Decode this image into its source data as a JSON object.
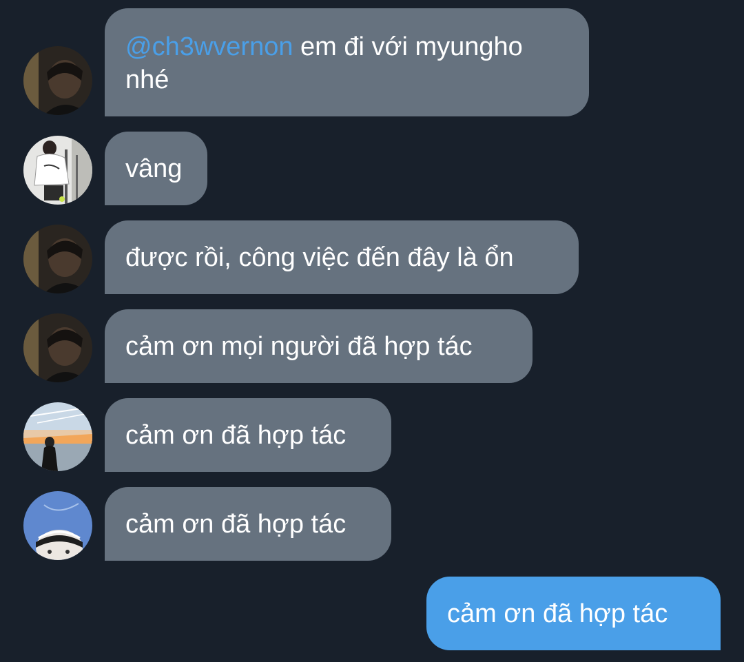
{
  "chat": {
    "background_color": "#18202b",
    "incoming_bubble_color": "#66727f",
    "outgoing_bubble_color": "#4a9fe8",
    "mention_color": "#4a9fe8",
    "messages": [
      {
        "sender": "incoming",
        "avatar": "avatar-dark-portrait",
        "mention": "@ch3wvernon",
        "text": " em đi với myungho nhé"
      },
      {
        "sender": "incoming",
        "avatar": "avatar-white-shirt",
        "text": "vâng"
      },
      {
        "sender": "incoming",
        "avatar": "avatar-dark-portrait",
        "text": "được rồi, công việc đến đây là ổn"
      },
      {
        "sender": "incoming",
        "avatar": "avatar-dark-portrait",
        "text": "cảm ơn mọi người đã hợp tác"
      },
      {
        "sender": "incoming",
        "avatar": "avatar-sunset-beach",
        "text": "cảm ơn đã hợp tác"
      },
      {
        "sender": "incoming",
        "avatar": "avatar-blue-sky-selfie",
        "text": "cảm ơn đã hợp tác"
      },
      {
        "sender": "outgoing",
        "text": "cảm ơn đã hợp tác"
      }
    ]
  }
}
